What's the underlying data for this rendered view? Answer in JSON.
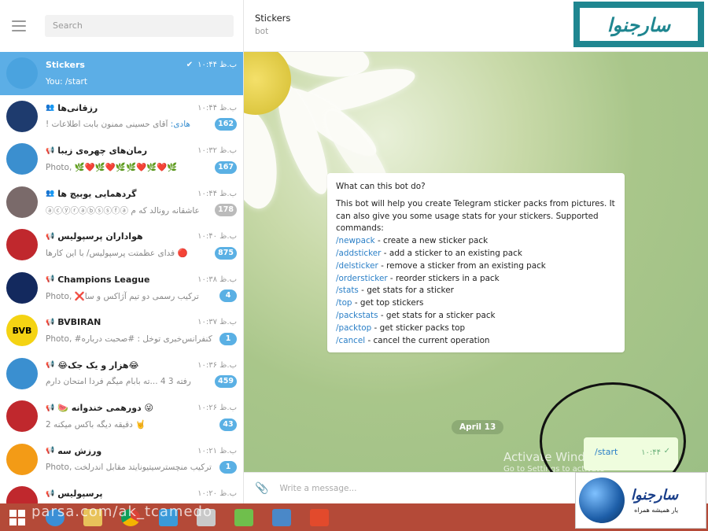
{
  "search": {
    "placeholder": "Search"
  },
  "chat_header": {
    "title": "Stickers",
    "status": "bot"
  },
  "chats": [
    {
      "name": "Stickers",
      "verified": true,
      "time": "ب.ظ ۱۰:۴۴",
      "preview": "You: /start",
      "badge": "",
      "active": true,
      "avatar_color": "#4aa3df",
      "avatar_text": ""
    },
    {
      "name": "رزقانی‌ها",
      "kind": "group",
      "time": "ب.ظ ۱۰:۴۴",
      "preview_hl": "هادی:",
      "preview": " آقای حسینی ممنون بابت اطلاعات !",
      "badge": "162",
      "avatar_color": "#1e3b6e",
      "avatar_text": ""
    },
    {
      "name": "رمان‌های چهره‌ی زیبا",
      "kind": "channel",
      "time": "ب.ظ ۱۰:۳۲",
      "preview": "Photo, 🌿❤️🌿❤️🌿🌿❤️🌿❤️🌿",
      "ltr": true,
      "badge": "167",
      "avatar_color": "#3b8fcf",
      "avatar_text": ""
    },
    {
      "name": "گردهمایی یوبیچ ها",
      "kind": "group",
      "time": "ب.ظ ۱۰:۴۴",
      "preview": "عاشقانه رونالد که م ⓐⓒⓨⓡⓐⓑⓢⓢⓕⓐ",
      "badge": "178",
      "badge_grey": true,
      "avatar_color": "#7a6a6a",
      "avatar_text": ""
    },
    {
      "name": "هواداران پرسپولیس",
      "kind": "channel",
      "time": "ب.ظ ۱۰:۴۰",
      "preview": "🔴 فدای عظمتت پرسپولیس/ با این کارها",
      "badge": "875",
      "avatar_color": "#c0282d",
      "avatar_text": ""
    },
    {
      "name": "Champions League",
      "kind": "channel",
      "time": "ب.ظ ۱۰:۳۸",
      "preview": "Photo, ❌ترکیب رسمی دو تیم آژاکس و سا",
      "ltr": true,
      "badge": "4",
      "avatar_color": "#13295e",
      "avatar_text": ""
    },
    {
      "name": "BVBIRAN",
      "kind": "channel",
      "time": "ب.ظ ۱۰:۳۷",
      "preview": "Photo, #کنفرانس‌خبری توخل : #صحبت درباره",
      "ltr": true,
      "badge": "1",
      "avatar_color": "#f4d313",
      "avatar_text": "BVB"
    },
    {
      "name": "😂هزار و یک جک😂",
      "kind": "channel",
      "time": "ب.ظ ۱۰:۳۶",
      "preview": "رفته 3 4 ...ته بابام میگم فردا امتحان دارم",
      "badge": "459",
      "avatar_color": "#3a8fd0",
      "avatar_text": ""
    },
    {
      "name": "🍉 دورهمی خندوانه 😜",
      "kind": "channel",
      "time": "ب.ظ ۱۰:۲۶",
      "preview": "🤘 دقیقه دیگه باکس میکنه 2",
      "badge": "43",
      "avatar_color": "#c0282d",
      "avatar_text": ""
    },
    {
      "name": "ورزش سه",
      "kind": "channel",
      "time": "ب.ظ ۱۰:۲۱",
      "preview": "Photo, ترکیب منچسترسیتیونایتد مقابل اندرلخت",
      "ltr": true,
      "badge": "1",
      "avatar_color": "#f39b16",
      "avatar_text": ""
    },
    {
      "name": "پرسپولیس",
      "kind": "channel",
      "time": "ب.ظ ۱۰:۲۰",
      "preview": "",
      "badge": "",
      "avatar_color": "#c0282d",
      "avatar_text": ""
    }
  ],
  "bot_info": {
    "question": "What can this bot do?",
    "intro": "This bot will help you create Telegram sticker packs from pictures. It can also give you some usage stats for your stickers. Supported commands:",
    "commands": [
      {
        "cmd": "/newpack",
        "desc": " - create a new sticker pack"
      },
      {
        "cmd": "/addsticker",
        "desc": " - add a sticker to an existing pack"
      },
      {
        "cmd": "/delsticker",
        "desc": " - remove a sticker from an existing pack"
      },
      {
        "cmd": "/ordersticker",
        "desc": " - reorder stickers in a pack"
      },
      {
        "cmd": "/stats",
        "desc": " - get stats for a sticker"
      },
      {
        "cmd": "/top",
        "desc": " - get top stickers"
      },
      {
        "cmd": "/packstats",
        "desc": " - get stats for a sticker pack"
      },
      {
        "cmd": "/packtop",
        "desc": " - get sticker packs top"
      },
      {
        "cmd": "/cancel",
        "desc": " - cancel the current operation"
      }
    ]
  },
  "date_pill": "April 13",
  "my_message": {
    "text": "/start",
    "time": "۱۰:۴۴",
    "check": "✓"
  },
  "windows_watermark": {
    "line1": "Activate Windows",
    "line2": "Go to Settings to activate"
  },
  "composer": {
    "placeholder": "Write a message..."
  },
  "bottom_watermark": "parsa.com/ak_tcamedo",
  "logo_top_text": "سارجنوا",
  "logo_bottom": {
    "brand": "سارجنوا",
    "sub": "یار همیشه همراه",
    "url": "http://www"
  },
  "colors": {
    "accent": "#5caee6",
    "taskbar": "#b44a38",
    "badge": "#5ab0e4",
    "logo": "#1f8690"
  }
}
